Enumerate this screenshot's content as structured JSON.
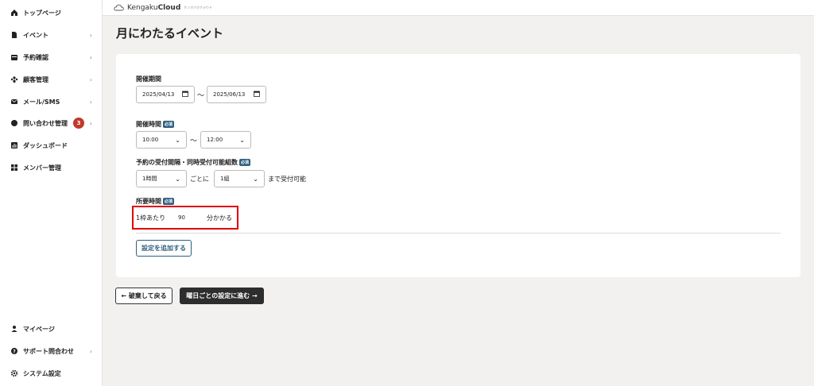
{
  "sidebar": {
    "items": [
      {
        "label": "トップページ",
        "icon": "home-icon",
        "chevron": ""
      },
      {
        "label": "イベント",
        "icon": "document-icon",
        "chevron": "›"
      },
      {
        "label": "予約確認",
        "icon": "calendar-icon",
        "chevron": "›"
      },
      {
        "label": "顧客管理",
        "icon": "people-icon",
        "chevron": "›"
      },
      {
        "label": "メール/SMS",
        "icon": "mail-icon",
        "chevron": "›"
      },
      {
        "label": "問い合わせ管理",
        "icon": "chat-icon",
        "chevron": "›",
        "badge": "3"
      },
      {
        "label": "ダッシュボード",
        "icon": "chart-icon",
        "chevron": ""
      },
      {
        "label": "メンバー管理",
        "icon": "grid-icon",
        "chevron": ""
      }
    ],
    "bottom": [
      {
        "label": "マイページ",
        "icon": "user-icon",
        "chevron": ""
      },
      {
        "label": "サポート問合わせ",
        "icon": "help-icon",
        "chevron": "›"
      },
      {
        "label": "システム設定",
        "icon": "gear-icon",
        "chevron": ""
      }
    ]
  },
  "header": {
    "brand_light": "Kengaku",
    "brand_bold": "Cloud",
    "brand_tag": "ケンガクグクラウド"
  },
  "page": {
    "title": "月にわたるイベント"
  },
  "form": {
    "period": {
      "label": "開催期間",
      "start": "2025/04/13",
      "end": "2025/06/13",
      "separator": "〜"
    },
    "time": {
      "label": "開催時間",
      "required": "必須",
      "start": "10:00",
      "end": "12:00",
      "separator": "〜"
    },
    "interval": {
      "label": "予約の受付間隔・同時受付可能組数",
      "required": "必須",
      "interval_value": "1時間",
      "mid_text": "ごとに",
      "groups_value": "1組",
      "end_text": "まで受付可能"
    },
    "duration": {
      "label": "所要時間",
      "required": "必須",
      "prefix": "1枠あたり",
      "value": "90",
      "suffix": "分かかる"
    },
    "add_setting_label": "設定を追加する"
  },
  "footer": {
    "back_label": "← 破棄して戻る",
    "next_label": "曜日ごとの設定に進む →"
  },
  "colors": {
    "accent": "#2e5f7f",
    "highlight": "#e00000",
    "badge": "#c0392b",
    "dark_button": "#2d2d2d"
  }
}
